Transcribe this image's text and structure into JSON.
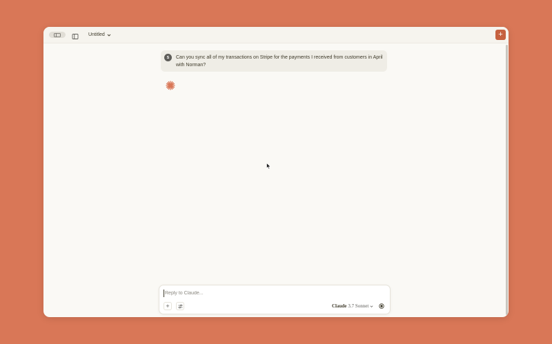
{
  "app": {
    "background_color": "#D97757",
    "accent_color": "#C6613F"
  },
  "titlebar": {
    "toggle_icon": "sidebar-toggle-icon",
    "sidebar_icon": "sidebar-panel-icon",
    "chat_title": "Untitled",
    "new_chat_icon": "plus-icon",
    "new_chat_symbol": "+"
  },
  "conversation": {
    "user_message": {
      "avatar_initial": "S",
      "text": "Can you sync all of my transactions on Stripe for the payments I received from customers in April with Norman?"
    },
    "assistant_status_icon": "claude-spark-icon"
  },
  "composer": {
    "placeholder": "Reply to Claude...",
    "value": "",
    "attach_symbol": "+",
    "model_brand": "Claude",
    "model_version": "3.7 Sonnet",
    "send_icon": "record-icon"
  }
}
